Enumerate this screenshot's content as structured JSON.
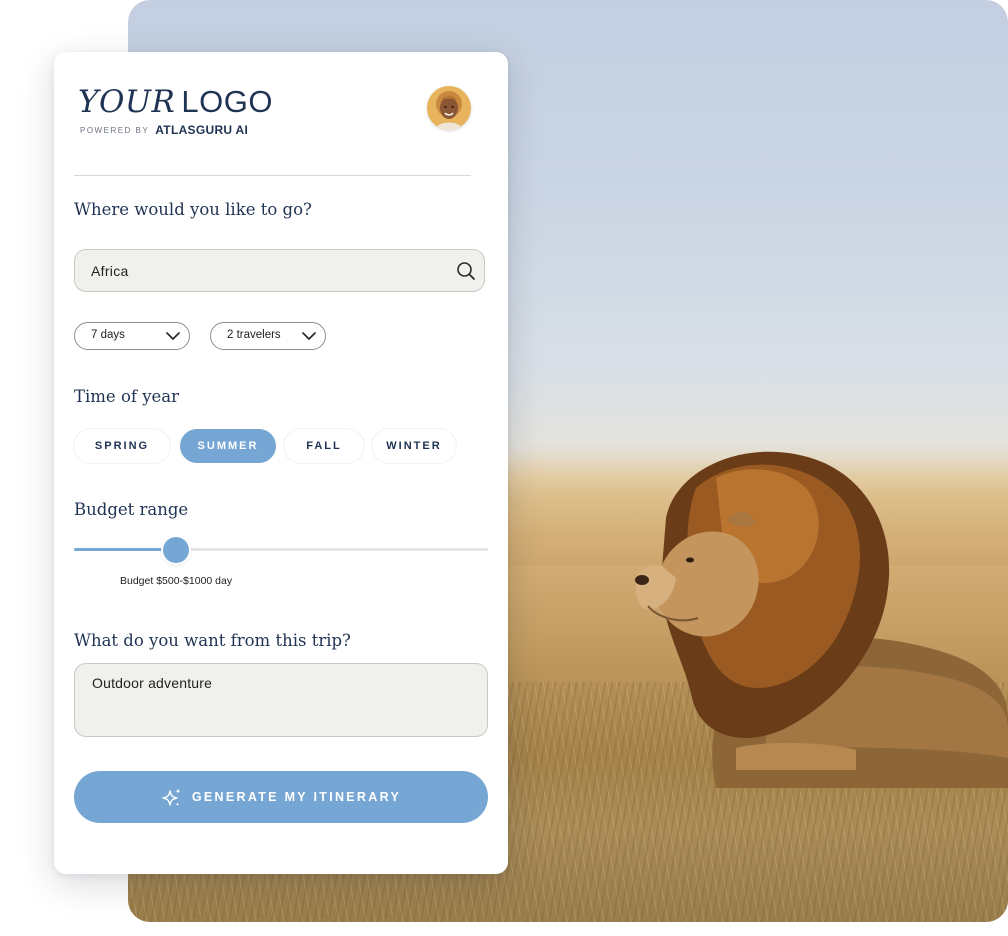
{
  "brand": {
    "logo_your": "YOUR",
    "logo_logo": "LOGO",
    "powered_by": "POWERED BY",
    "powered_brand": "ATLASGURU AI"
  },
  "profile": {
    "avatar_icon": "user-avatar"
  },
  "destination": {
    "heading": "Where would you like to go?",
    "value": "Africa",
    "icon": "search-icon"
  },
  "trip_options": {
    "duration": "7 days",
    "travelers": "2 travelers"
  },
  "time_of_year": {
    "heading": "Time of year",
    "options": [
      "SPRING",
      "SUMMER",
      "FALL",
      "WINTER"
    ],
    "selected": "SUMMER"
  },
  "budget": {
    "heading": "Budget range",
    "label": "Budget $500-$1000 day",
    "slider_value_fraction": 0.25
  },
  "preferences": {
    "heading": "What do you want from this trip?",
    "value": "Outdoor adventure"
  },
  "cta": {
    "label": "GENERATE MY ITINERARY",
    "icon": "sparkle-icon"
  },
  "colors": {
    "accent": "#76a6d3",
    "text_dark": "#1f3353",
    "input_bg": "#f0f0ec"
  }
}
